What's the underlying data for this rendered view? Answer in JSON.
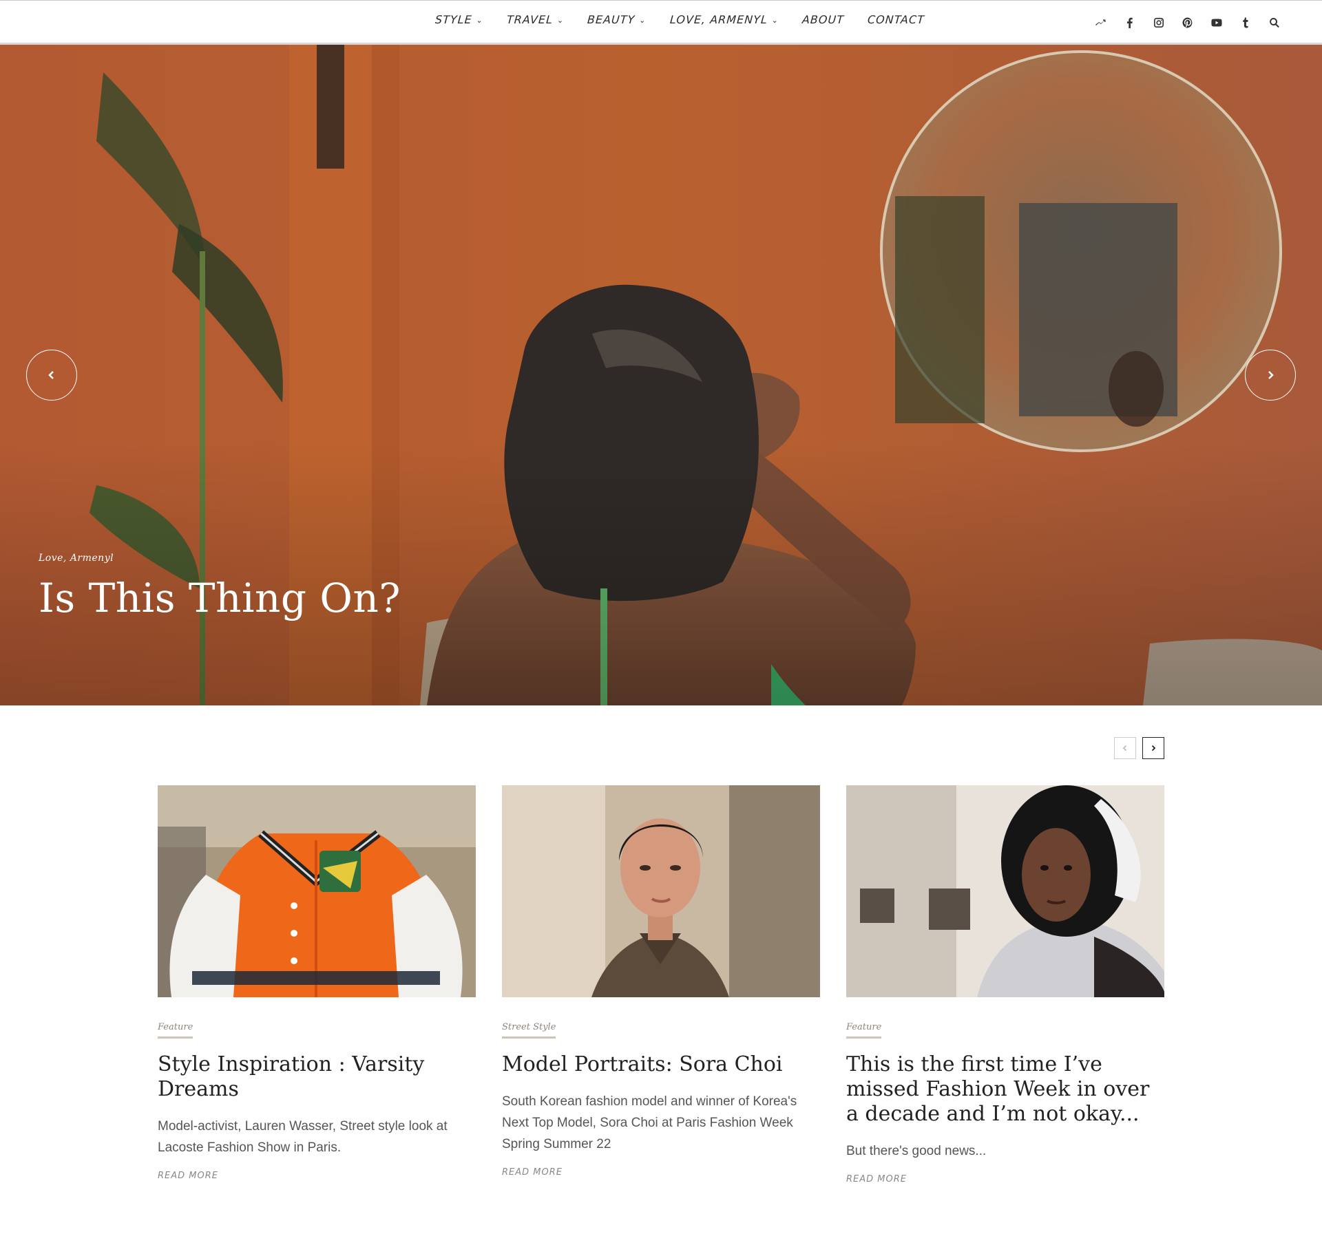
{
  "nav": {
    "items": [
      {
        "label": "STYLE",
        "has_dropdown": true
      },
      {
        "label": "TRAVEL",
        "has_dropdown": true
      },
      {
        "label": "BEAUTY",
        "has_dropdown": true
      },
      {
        "label": "LOVE, ARMENYL",
        "has_dropdown": true
      },
      {
        "label": "ABOUT",
        "has_dropdown": false
      },
      {
        "label": "CONTACT",
        "has_dropdown": false
      }
    ],
    "social_icons": [
      "trending-icon",
      "facebook-icon",
      "instagram-icon",
      "pinterest-icon",
      "youtube-icon",
      "tumblr-icon",
      "search-icon"
    ]
  },
  "hero": {
    "category": "Love, Armenyl",
    "title": "Is This Thing On?"
  },
  "cards": [
    {
      "category": "Feature",
      "title": "Style Inspiration : Varsity Dreams",
      "excerpt": "Model-activist, Lauren Wasser, Street style look at Lacoste Fashion Show in Paris.",
      "read_more": "READ MORE"
    },
    {
      "category": "Street Style",
      "title": "Model Portraits: Sora Choi",
      "excerpt": "South Korean fashion model and winner of Korea's Next Top Model, Sora Choi at Paris Fashion Week Spring Summer 22",
      "read_more": "READ MORE"
    },
    {
      "category": "Feature",
      "title": "This is the first time I’ve missed Fashion Week in over a decade and I’m not okay...",
      "excerpt": "But there's good news...",
      "read_more": "READ MORE"
    }
  ],
  "colors": {
    "hero_wall": "#b4582e",
    "accent_underline": "#cfc4b8"
  }
}
